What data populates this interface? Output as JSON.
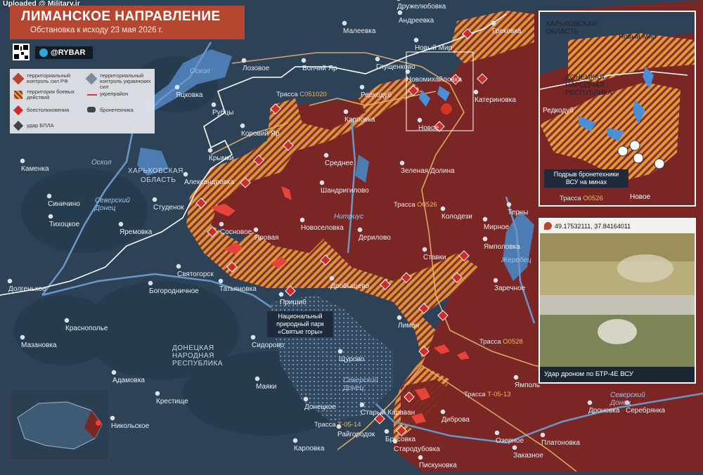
{
  "header": {
    "uploaded": "Uploaded @ Military.ir",
    "title": "ЛИМАНСКОЕ НАПРАВЛЕНИЕ",
    "subtitle": "Обстановка к исходу 23 мая 2026 г.",
    "brand": "@RYBAR"
  },
  "legend": {
    "items": [
      {
        "label": "территориальный контроль сил РФ",
        "color": "#b5462f"
      },
      {
        "label": "территориальный контроль украинских сил",
        "color": "#7d8b9a"
      },
      {
        "label": "территория боевых действий",
        "color": "#e29a3f"
      },
      {
        "label": "укрепрайон",
        "color": "#d03a3a"
      },
      {
        "label": "боестолкновения",
        "color": "#d02a2a"
      },
      {
        "label": "бронетехника",
        "color": "#444444"
      },
      {
        "label": "удар БПЛА",
        "color": "#444444"
      }
    ]
  },
  "colors": {
    "ru_control": "#7a2624",
    "ua_control": "#2d4157",
    "contested": "#e09a3a",
    "water": "#4d7cb2",
    "accent": "#b5462f"
  },
  "regions": [
    {
      "name": "ХАРЬКОВСКАЯ ОБЛАСТЬ"
    },
    {
      "name": "ДОНЕЦКАЯ НАРОДНАЯ РЕСПУБЛИКА"
    }
  ],
  "rivers": [
    "Оскол",
    "Оскол",
    "Северский Донец",
    "Нитриус",
    "Жеребец",
    "Северский Донец",
    "Северский Донец"
  ],
  "roads": [
    {
      "prefix": "Трасса",
      "num": "С051020"
    },
    {
      "prefix": "Трасса",
      "num": "О0526"
    },
    {
      "prefix": "Трасса",
      "num": "О0528"
    },
    {
      "prefix": "Трасса",
      "num": "Т-05-13"
    },
    {
      "prefix": "Трасса",
      "num": "Т-05-14"
    }
  ],
  "park": "Национальный природный парк «Святые горы»",
  "towns": [
    "Дружелюбовка",
    "Андреевка",
    "Малеевка",
    "Грековка",
    "Новый Мир",
    "Глущенково",
    "Лозовое",
    "Волчий Яр",
    "Новомихайловка",
    "Редкодуб",
    "Катериновка",
    "Новое",
    "Яцковка",
    "Рубцы",
    "Карповка",
    "Коровий Яр",
    "Крымки",
    "Среднее",
    "Каменка",
    "Александровка",
    "Зеленая Долина",
    "Шандригилово",
    "Синичино",
    "Студенок",
    "Тихоцкое",
    "Яремовка",
    "Сосновое",
    "Новоселовка",
    "Колодези",
    "Терны",
    "Яровая",
    "Дерилово",
    "Мирное",
    "Ямполовка",
    "Святогорск",
    "Ставки",
    "Богородничное",
    "Татьяновка",
    "Дробышево",
    "Заречное",
    "Долгенькое",
    "Пришиб",
    "Лиман",
    "Краснополье",
    "Мазановка",
    "Сидорово",
    "Щурово",
    "Адамовка",
    "Маяки",
    "Крестище",
    "Донецкое",
    "Ямполь",
    "Дроновка",
    "Серебрянка",
    "Никольское",
    "Старый Караван",
    "Диброва",
    "Райгородок",
    "Брусовка",
    "Стародубовка",
    "Озерное",
    "Платоновка",
    "Карповка",
    "Заказное",
    "Пискуновка"
  ],
  "inset_map": {
    "regions": [
      "ХАРЬКОВСКАЯ ОБЛАСТЬ",
      "ДОНЕЦКАЯ НАРОДНАЯ РЕСПУБЛИКА"
    ],
    "towns": [
      "Новый Мир",
      "Редкодуб",
      "Новое"
    ],
    "road": {
      "prefix": "Трасса",
      "num": "О0526"
    },
    "callout": "Подрыв бронетехники ВСУ на минах"
  },
  "inset_video": {
    "coords": "49.17532111, 37.84164011",
    "caption": "Удар дроном по БТР-4Е ВСУ"
  }
}
